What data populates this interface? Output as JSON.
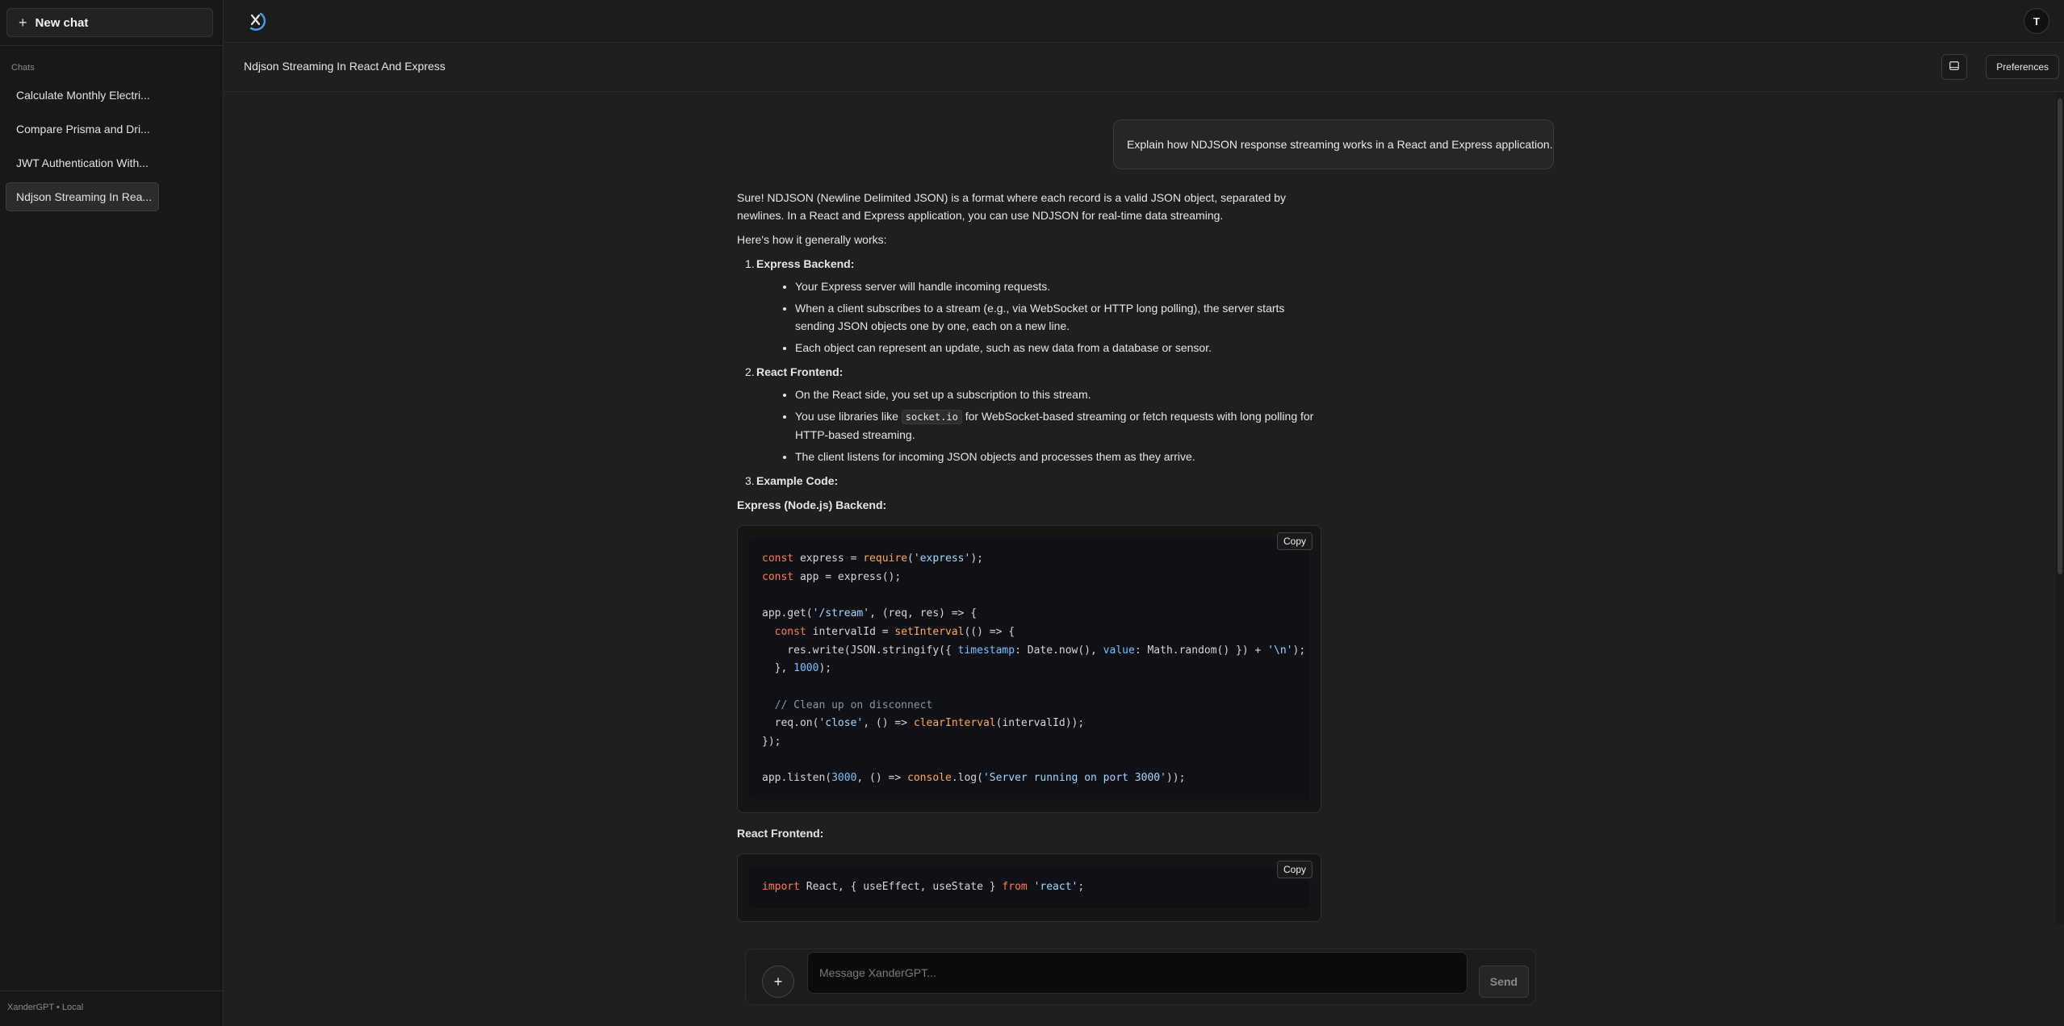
{
  "sidebar": {
    "new_chat_label": "New chat",
    "chats_heading": "Chats",
    "items": [
      {
        "label": "Calculate Monthly Electri..."
      },
      {
        "label": "Compare Prisma and Dri..."
      },
      {
        "label": "JWT Authentication With..."
      },
      {
        "label": "Ndjson Streaming In Rea..."
      }
    ],
    "footer": "XanderGPT • Local"
  },
  "header": {
    "avatar_initial": "T",
    "conversation_title": "Ndjson Streaming In React And Express",
    "preferences_label": "Preferences"
  },
  "conversation": {
    "user_message": "Explain how NDJSON response streaming works in a React and Express application.",
    "intro": "Sure! NDJSON (Newline Delimited JSON) is a format where each record is a valid JSON object, separated by newlines. In a React and Express application, you can use NDJSON for real-time data streaming.",
    "how_it_works": "Here's how it generally works:",
    "steps": [
      {
        "num": "1.",
        "title": "Express Backend:",
        "bullets": [
          "Your Express server will handle incoming requests.",
          "When a client subscribes to a stream (e.g., via WebSocket or HTTP long polling), the server starts sending JSON objects one by one, each on a new line.",
          "Each object can represent an update, such as new data from a database or sensor."
        ]
      },
      {
        "num": "2.",
        "title": "React Frontend:",
        "bullets": [
          "On the React side, you set up a subscription to this stream.",
          "You use libraries like",
          "The client listens for incoming JSON objects and processes them as they arrive."
        ],
        "inline_code": "socket.io",
        "bullet2_tail": "for WebSocket-based streaming or fetch requests with long polling for HTTP-based streaming."
      },
      {
        "num": "3.",
        "title": "Example Code:"
      }
    ],
    "backend_label": "Express (Node.js) Backend:",
    "frontend_label": "React Frontend:",
    "copy_label": "Copy",
    "code_express": [
      "const express = require('express');",
      "const app = express();",
      "",
      "app.get('/stream', (req, res) => {",
      "  const intervalId = setInterval(() => {",
      "    res.write(JSON.stringify({ timestamp: Date.now(), value: Math.random() }) + '\\n');",
      "  }, 1000);",
      "",
      "  // Clean up on disconnect",
      "  req.on('close', () => clearInterval(intervalId));",
      "});",
      "",
      "app.listen(3000, () => console.log('Server running on port 3000'));"
    ],
    "code_react": [
      "import React, { useEffect, useState } from 'react';"
    ]
  },
  "composer": {
    "attach_label": "+",
    "placeholder": "Message XanderGPT...",
    "send_label": "Send"
  },
  "colors": {
    "background": "#1f1f1f",
    "sidebar": "#181818",
    "code_background": "#0f1116",
    "keyword": "#ff7b54",
    "string": "#a5d6ff",
    "logo_accent": "#4a9fe8"
  },
  "icons": {
    "logo": "xandergpt-logo-icon",
    "panel": "sidebar-panel-icon",
    "plus": "plus-icon"
  }
}
